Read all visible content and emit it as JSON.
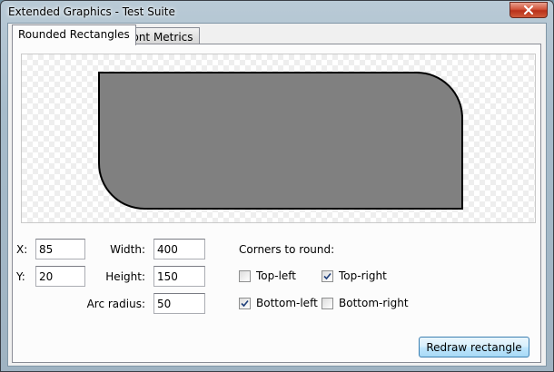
{
  "window": {
    "title": "Extended Graphics - Test Suite"
  },
  "tabs": [
    {
      "label": "Rounded Rectangles",
      "active": true
    },
    {
      "label": "Font Metrics",
      "active": false
    }
  ],
  "form": {
    "x_label": "X:",
    "x_value": "85",
    "y_label": "Y:",
    "y_value": "20",
    "width_label": "Width:",
    "width_value": "400",
    "height_label": "Height:",
    "height_value": "150",
    "arc_label": "Arc radius:",
    "arc_value": "50"
  },
  "corners": {
    "heading": "Corners to round:",
    "top_left": {
      "label": "Top-left",
      "checked": false
    },
    "top_right": {
      "label": "Top-right",
      "checked": true
    },
    "bottom_left": {
      "label": "Bottom-left",
      "checked": true
    },
    "bottom_right": {
      "label": "Bottom-right",
      "checked": false
    }
  },
  "button": {
    "label": "Redraw rectangle"
  },
  "rect": {
    "fill": "#808080",
    "stroke": "#000000"
  },
  "icons": {
    "close": "close-icon",
    "check": "check-icon"
  }
}
